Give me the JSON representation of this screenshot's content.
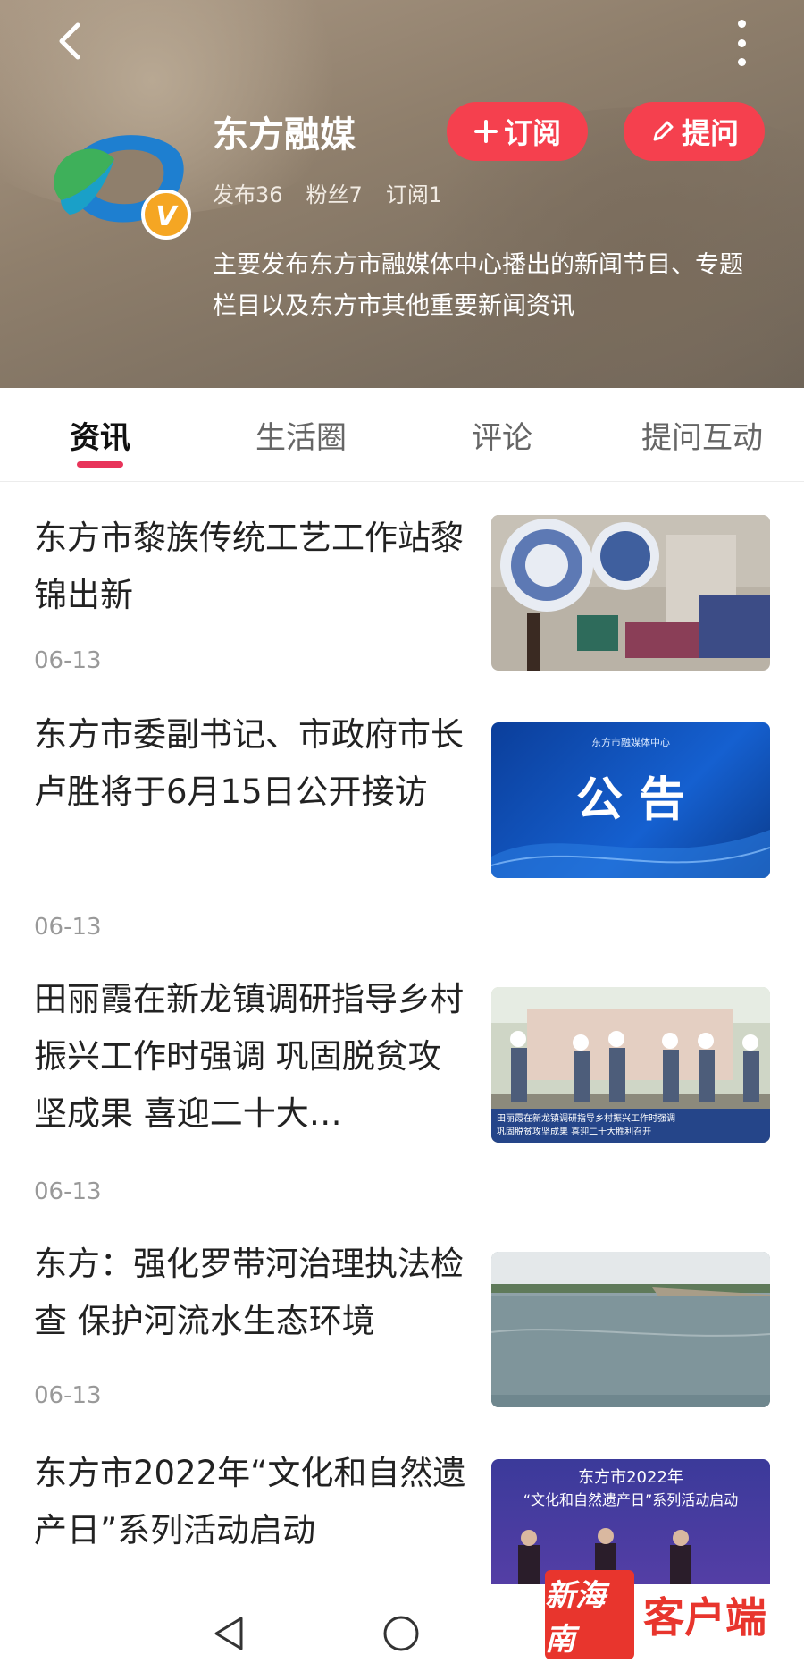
{
  "header": {
    "name": "东方融媒",
    "stats": {
      "published": "发布36",
      "fans": "粉丝7",
      "subscribed": "订阅1"
    },
    "description": "主要发布东方市融媒体中心播出的新闻节目、专题栏目以及东方市其他重要新闻资讯",
    "subscribe_label": "订阅",
    "ask_label": "提问",
    "badge_letter": "V"
  },
  "tabs": [
    {
      "label": "资讯",
      "active": true
    },
    {
      "label": "生活圈",
      "active": false
    },
    {
      "label": "评论",
      "active": false
    },
    {
      "label": "提问互动",
      "active": false
    }
  ],
  "news": [
    {
      "title": "东方市黎族传统工艺工作站黎锦出新",
      "date": "06-13"
    },
    {
      "title": "东方市委副书记、市政府市长卢胜将于6月15日公开接访",
      "date": "06-13",
      "thumb_text": "公 告",
      "thumb_caption": "东方市融媒体中心"
    },
    {
      "title": "田丽霞在新龙镇调研指导乡村振兴工作时强调 巩固脱贫攻坚成果 喜迎二十大…",
      "date": "06-13",
      "thumb_caption_1": "田丽霞在新龙镇调研指导乡村振兴工作时强调",
      "thumb_caption_2": "巩固脱贫攻坚成果 喜迎二十大胜利召开"
    },
    {
      "title": "东方：强化罗带河治理执法检查 保护河流水生态环境",
      "date": "06-13"
    },
    {
      "title": "东方市2022年“文化和自然遗产日”系列活动启动",
      "date": "",
      "thumb_line_1": "东方市2022年",
      "thumb_line_2": "“文化和自然遗产日”系列活动启动"
    }
  ],
  "watermark": {
    "logo_text": "新海南",
    "text": "客户端"
  },
  "colors": {
    "accent": "#f5404e",
    "tab_indicator": "#e8345a",
    "watermark": "#e8352d"
  }
}
